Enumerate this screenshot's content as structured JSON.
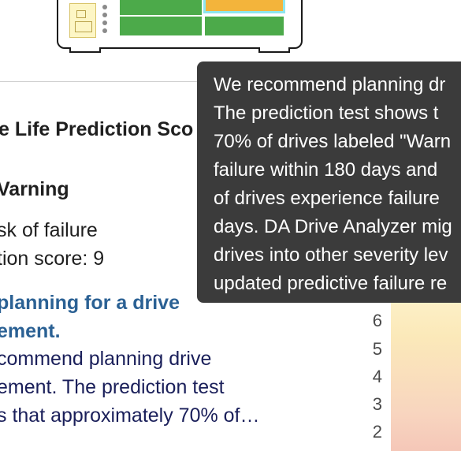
{
  "prediction": {
    "heading": "e Life Prediction Sco",
    "severity": "Varning",
    "risk": "sk of failure",
    "score": "tion score: 9",
    "recommendation_title": [
      "planning for a drive",
      "ement."
    ],
    "recommendation_body": [
      "commend planning drive",
      "ement. The prediction test",
      "s that approximately 70% of…"
    ]
  },
  "chart": {
    "y_ticks": [
      "6",
      "5",
      "4",
      "3",
      "2"
    ]
  },
  "tooltip": {
    "lines": [
      "We recommend planning dr",
      "The prediction test shows t",
      "70% of drives labeled \"Warn",
      "failure within 180 days and",
      "of drives experience failure",
      "days. DA Drive Analyzer mig",
      "drives into other severity lev",
      "updated predictive failure re"
    ]
  },
  "colors": {
    "drive_ok": "#4caa4a",
    "drive_warning": "#f3b43b",
    "link_blue": "#2b6194",
    "tooltip_bg": "#3b3b3b"
  }
}
